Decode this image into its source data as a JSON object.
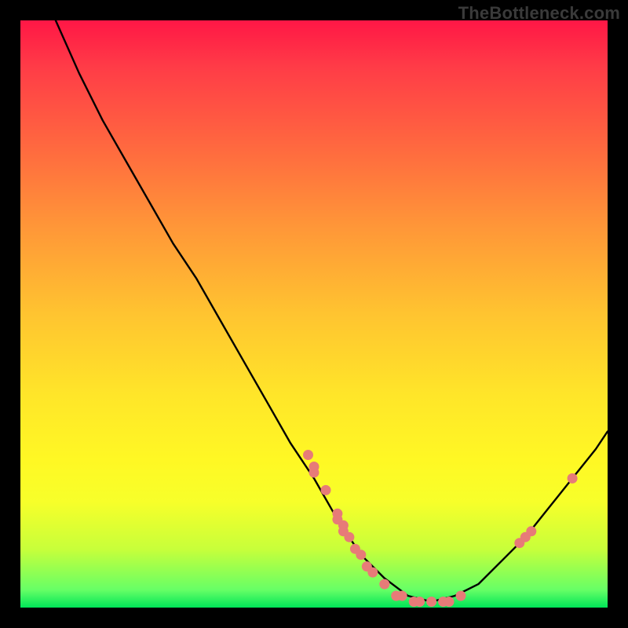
{
  "watermark": "TheBottleneck.com",
  "colors": {
    "background": "#000000",
    "curve": "#000000",
    "marker": "#e77b78",
    "gradient_top": "#ff1746",
    "gradient_bottom": "#00e558"
  },
  "chart_data": {
    "type": "line",
    "title": "",
    "xlabel": "",
    "ylabel": "",
    "xlim": [
      0,
      100
    ],
    "ylim": [
      0,
      100
    ],
    "curve": [
      {
        "x": 6,
        "y": 100
      },
      {
        "x": 10,
        "y": 91
      },
      {
        "x": 14,
        "y": 83
      },
      {
        "x": 18,
        "y": 76
      },
      {
        "x": 22,
        "y": 69
      },
      {
        "x": 26,
        "y": 62
      },
      {
        "x": 30,
        "y": 56
      },
      {
        "x": 34,
        "y": 49
      },
      {
        "x": 38,
        "y": 42
      },
      {
        "x": 42,
        "y": 35
      },
      {
        "x": 46,
        "y": 28
      },
      {
        "x": 50,
        "y": 22
      },
      {
        "x": 54,
        "y": 15
      },
      {
        "x": 58,
        "y": 9
      },
      {
        "x": 62,
        "y": 5
      },
      {
        "x": 66,
        "y": 2
      },
      {
        "x": 70,
        "y": 1
      },
      {
        "x": 74,
        "y": 2
      },
      {
        "x": 78,
        "y": 4
      },
      {
        "x": 82,
        "y": 8
      },
      {
        "x": 86,
        "y": 12
      },
      {
        "x": 90,
        "y": 17
      },
      {
        "x": 94,
        "y": 22
      },
      {
        "x": 98,
        "y": 27
      },
      {
        "x": 100,
        "y": 30
      }
    ],
    "markers": [
      {
        "x": 49,
        "y": 26
      },
      {
        "x": 50,
        "y": 24
      },
      {
        "x": 50,
        "y": 23
      },
      {
        "x": 52,
        "y": 20
      },
      {
        "x": 54,
        "y": 16
      },
      {
        "x": 54,
        "y": 15
      },
      {
        "x": 55,
        "y": 14
      },
      {
        "x": 55,
        "y": 13
      },
      {
        "x": 56,
        "y": 12
      },
      {
        "x": 57,
        "y": 10
      },
      {
        "x": 58,
        "y": 9
      },
      {
        "x": 59,
        "y": 7
      },
      {
        "x": 60,
        "y": 6
      },
      {
        "x": 62,
        "y": 4
      },
      {
        "x": 64,
        "y": 2
      },
      {
        "x": 65,
        "y": 2
      },
      {
        "x": 67,
        "y": 1
      },
      {
        "x": 68,
        "y": 1
      },
      {
        "x": 70,
        "y": 1
      },
      {
        "x": 72,
        "y": 1
      },
      {
        "x": 73,
        "y": 1
      },
      {
        "x": 75,
        "y": 2
      },
      {
        "x": 85,
        "y": 11
      },
      {
        "x": 86,
        "y": 12
      },
      {
        "x": 87,
        "y": 13
      },
      {
        "x": 94,
        "y": 22
      }
    ]
  }
}
